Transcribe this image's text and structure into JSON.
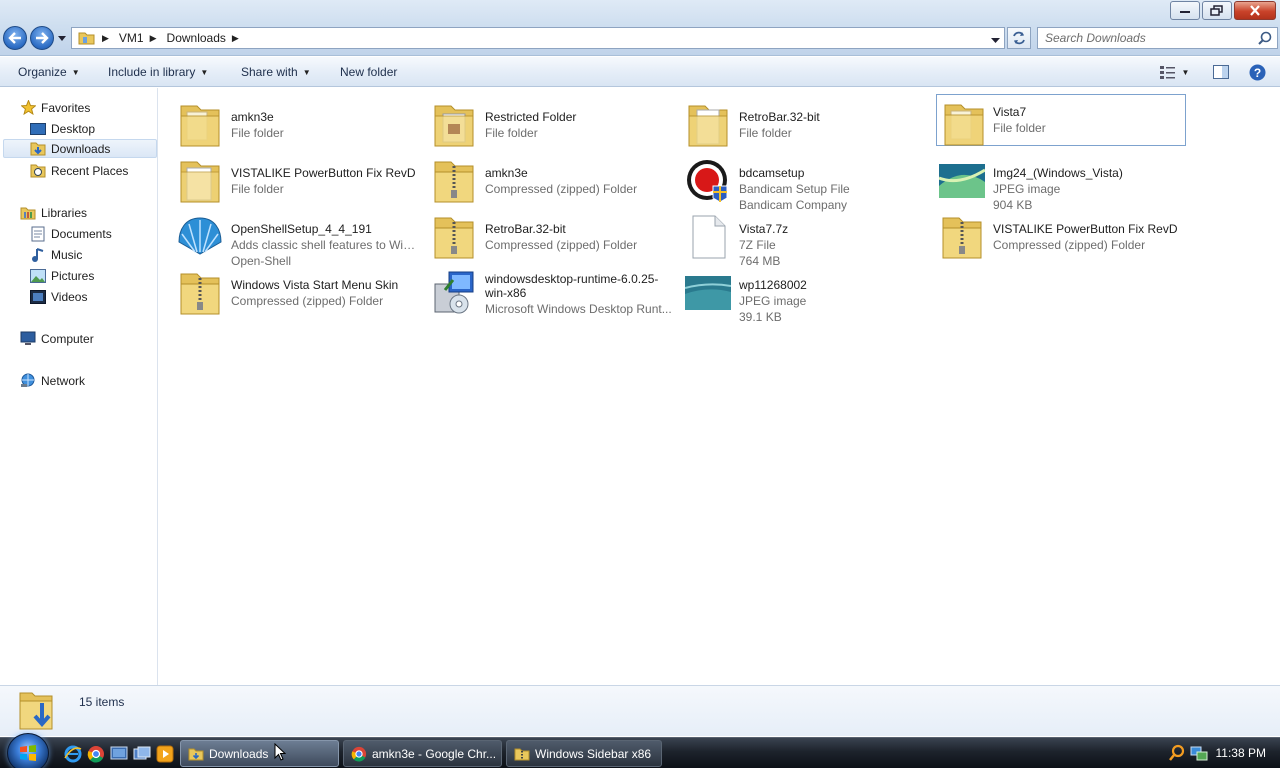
{
  "window": {
    "colors": {
      "accent": "#2c6cc4",
      "selection": "#cce8ff",
      "close": "#c9432a"
    }
  },
  "address": {
    "crumbs": [
      "VM1",
      "Downloads"
    ]
  },
  "search": {
    "placeholder": "Search Downloads"
  },
  "commandbar": {
    "organize": "Organize",
    "include_in_library": "Include in library",
    "share_with": "Share with",
    "new_folder": "New folder"
  },
  "navigation": {
    "favorites": "Favorites",
    "desktop": "Desktop",
    "downloads": "Downloads",
    "recent_places": "Recent Places",
    "libraries": "Libraries",
    "documents": "Documents",
    "music": "Music",
    "pictures": "Pictures",
    "videos": "Videos",
    "computer": "Computer",
    "network": "Network"
  },
  "files": [
    {
      "name": "amkn3e",
      "line2": "File folder",
      "line3": "",
      "icon": "folder-icon"
    },
    {
      "name": "Restricted Folder",
      "line2": "File folder",
      "line3": "",
      "icon": "folder-icon"
    },
    {
      "name": "RetroBar.32-bit",
      "line2": "File folder",
      "line3": "",
      "icon": "folder-icon"
    },
    {
      "name": "Vista7",
      "line2": "File folder",
      "line3": "",
      "icon": "folder-icon",
      "selected": true
    },
    {
      "name": "VISTALIKE PowerButton Fix RevD",
      "line2": "File folder",
      "line3": "",
      "icon": "folder-icon"
    },
    {
      "name": "amkn3e",
      "line2": "Compressed (zipped) Folder",
      "line3": "",
      "icon": "zip-folder-icon"
    },
    {
      "name": "bdcamsetup",
      "line2": "Bandicam Setup File",
      "line3": "Bandicam Company",
      "icon": "bandicam-icon"
    },
    {
      "name": "Img24_(Windows_Vista)",
      "line2": "JPEG image",
      "line3": "904 KB",
      "icon": "image-thumbnail-icon"
    },
    {
      "name": "OpenShellSetup_4_4_191",
      "line2": "Adds classic shell features to Win...",
      "line3": "Open-Shell",
      "icon": "shell-icon"
    },
    {
      "name": "RetroBar.32-bit",
      "line2": "Compressed (zipped) Folder",
      "line3": "",
      "icon": "zip-folder-icon"
    },
    {
      "name": "Vista7.7z",
      "line2": "7Z File",
      "line3": "764 MB",
      "icon": "file-icon"
    },
    {
      "name": "VISTALIKE PowerButton Fix RevD",
      "line2": "Compressed (zipped) Folder",
      "line3": "",
      "icon": "zip-folder-icon"
    },
    {
      "name": "Windows Vista Start Menu Skin",
      "line2": "Compressed (zipped) Folder",
      "line3": "",
      "icon": "zip-folder-icon"
    },
    {
      "name": "windowsdesktop-runtime-6.0.25-win-x86",
      "line2": "Microsoft Windows Desktop Runt...",
      "line3": "",
      "icon": "installer-icon"
    },
    {
      "name": "wp11268002",
      "line2": "JPEG image",
      "line3": "39.1 KB",
      "icon": "image-thumbnail-icon"
    }
  ],
  "details": {
    "count": "15 items"
  },
  "taskbar": {
    "tasks": [
      "Downloads",
      "amkn3e - Google Chr...",
      "Windows Sidebar x86"
    ],
    "clock": "11:38 PM"
  }
}
